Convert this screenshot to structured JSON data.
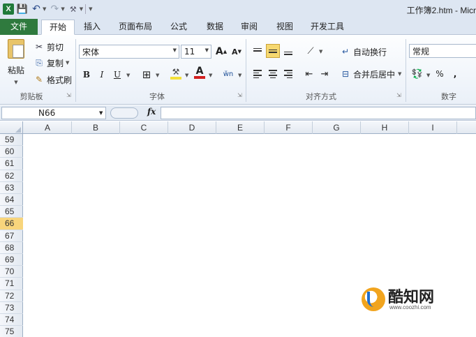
{
  "window": {
    "title": "工作簿2.htm - Micr"
  },
  "tabs": {
    "file": "文件",
    "items": [
      "开始",
      "插入",
      "页面布局",
      "公式",
      "数据",
      "审阅",
      "视图",
      "开发工具"
    ],
    "active": "开始"
  },
  "clipboard": {
    "paste": "粘贴",
    "cut": "剪切",
    "copy": "复制",
    "format_painter": "格式刷",
    "group_label": "剪贴板"
  },
  "font": {
    "name": "宋体",
    "size": "11",
    "grow": "A",
    "shrink": "A",
    "bold": "B",
    "italic": "I",
    "underline": "U",
    "font_color_letter": "A",
    "font_color": "#d21f1f",
    "fill_color": "#f4e03a",
    "group_label": "字体"
  },
  "alignment": {
    "wrap_text": "自动换行",
    "merge_center": "合并后居中",
    "group_label": "对齐方式"
  },
  "number": {
    "format": "常规",
    "percent": "%",
    "comma": ",",
    "group_label": "数字"
  },
  "formula_bar": {
    "name_box": "N66",
    "fx": "fx",
    "value": ""
  },
  "grid": {
    "columns": [
      "A",
      "B",
      "C",
      "D",
      "E",
      "F",
      "G",
      "H",
      "I"
    ],
    "rows": [
      "59",
      "60",
      "61",
      "62",
      "63",
      "64",
      "65",
      "66",
      "67",
      "68",
      "69",
      "70",
      "71",
      "72",
      "73",
      "74",
      "75"
    ],
    "active_row": "66"
  },
  "watermark": {
    "text": "酷知网",
    "url": "www.coozhi.com"
  }
}
